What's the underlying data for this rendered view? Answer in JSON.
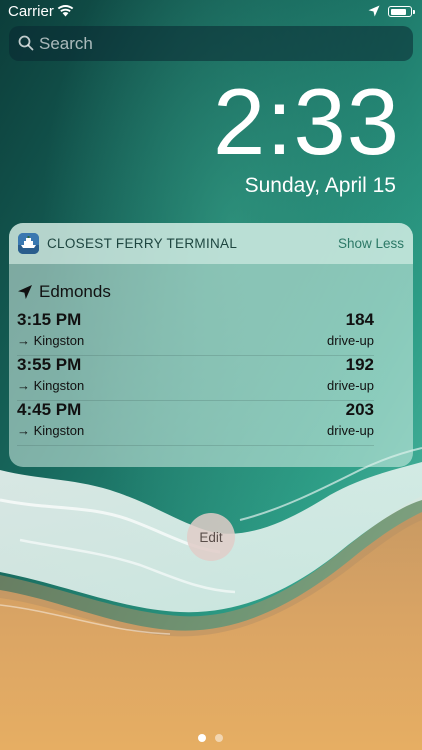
{
  "status_bar": {
    "carrier": "Carrier",
    "icons": [
      "wifi-icon",
      "location-arrow-icon",
      "battery-icon"
    ],
    "battery_level": 0.85
  },
  "search": {
    "placeholder": "Search",
    "icon": "search-icon"
  },
  "lock_screen": {
    "time": "2:33",
    "date": "Sunday, April 15"
  },
  "widget": {
    "title": "CLOSEST FERRY TERMINAL",
    "toggle_label": "Show Less",
    "app_icon": "ferry-app-icon",
    "terminal": {
      "icon": "navigation-arrow-icon",
      "name": "Edmonds"
    },
    "trips": [
      {
        "time": "3:15 PM",
        "destination": "→ Kingston",
        "spaces": "184",
        "unit": "drive-up"
      },
      {
        "time": "3:55 PM",
        "destination": "→ Kingston",
        "spaces": "192",
        "unit": "drive-up"
      },
      {
        "time": "4:45 PM",
        "destination": "→ Kingston",
        "spaces": "203",
        "unit": "drive-up"
      }
    ]
  },
  "edit_button": {
    "label": "Edit"
  },
  "page_indicator": {
    "pages": 2,
    "current": 1
  },
  "colors": {
    "accent_show_less": "#2c7866",
    "widget_title": "#1e4640",
    "sea_dark": "#0f4a43",
    "sand": "#d9a160"
  }
}
